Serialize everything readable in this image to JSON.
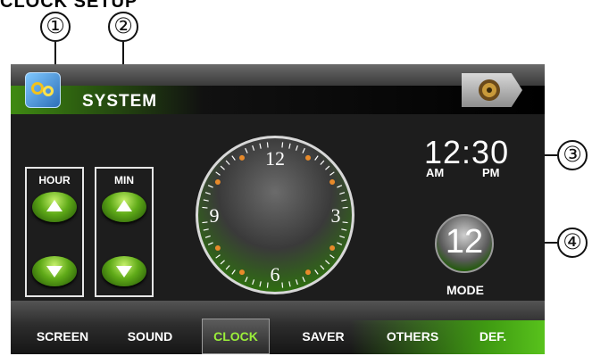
{
  "heading": "CLOCK SETUP",
  "callouts": [
    "①",
    "②",
    "③",
    "④"
  ],
  "header": {
    "title": "SYSTEM",
    "app_icon": "system-gear-icon",
    "speaker_icon": "speaker-icon"
  },
  "hour": {
    "label": "HOUR",
    "up_icon": "arrow-up-icon",
    "down_icon": "arrow-down-icon"
  },
  "min": {
    "label": "MIN",
    "up_icon": "arrow-up-icon",
    "down_icon": "arrow-down-icon"
  },
  "clock": {
    "numerals": [
      "12",
      "3",
      "6",
      "9"
    ]
  },
  "time": {
    "display": "12:30",
    "am": "AM",
    "pm": "PM"
  },
  "mode": {
    "value": "12",
    "label": "MODE"
  },
  "tabs": [
    {
      "label": "SCREEN",
      "active": false
    },
    {
      "label": "SOUND",
      "active": false
    },
    {
      "label": "CLOCK",
      "active": true
    },
    {
      "label": "SAVER",
      "active": false
    },
    {
      "label": "OTHERS",
      "active": false
    },
    {
      "label": "DEF.",
      "active": false
    }
  ],
  "colors": {
    "accent_green": "#5fc21e",
    "active_tab_text": "#9bef3a",
    "tick_dot": "#e88a2a"
  }
}
